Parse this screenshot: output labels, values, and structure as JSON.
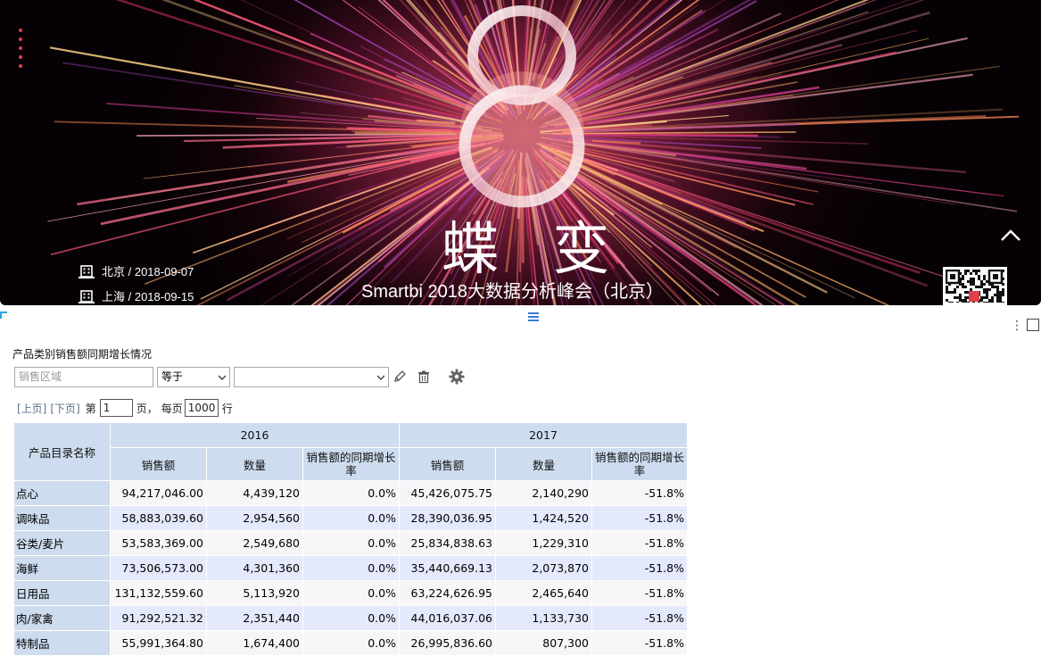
{
  "banner": {
    "title": "蝶 变",
    "subtitle": "Smartbi 2018大数据分析峰会（北京）",
    "locations": [
      {
        "label": "北京 / 2018-09-07"
      },
      {
        "label": "上海 / 2018-09-15"
      }
    ],
    "accent_color": "#e0404a"
  },
  "report": {
    "title": "产品类别销售额同期增长情况",
    "filter": {
      "field_placeholder": "销售区域",
      "operator": "等于",
      "value": ""
    },
    "pager": {
      "prev": "[上页]",
      "next": "[下页]",
      "page_prefix": "第",
      "page_value": "1",
      "page_suffix": "页，",
      "per_page_prefix": "每页",
      "per_page_value": "1000",
      "per_page_suffix": "行"
    },
    "table": {
      "corner_header": "产品目录名称",
      "years": [
        "2016",
        "2017"
      ],
      "metrics": [
        "销售额",
        "数量",
        "销售额的同期增长率"
      ],
      "rows": [
        {
          "name": "点心",
          "c": [
            "94,217,046.00",
            "4,439,120",
            "0.0%",
            "45,426,075.75",
            "2,140,290",
            "-51.8%"
          ]
        },
        {
          "name": "调味品",
          "c": [
            "58,883,039.60",
            "2,954,560",
            "0.0%",
            "28,390,036.95",
            "1,424,520",
            "-51.8%"
          ]
        },
        {
          "name": "谷类/麦片",
          "c": [
            "53,583,369.00",
            "2,549,680",
            "0.0%",
            "25,834,838.63",
            "1,229,310",
            "-51.8%"
          ]
        },
        {
          "name": "海鲜",
          "c": [
            "73,506,573.00",
            "4,301,360",
            "0.0%",
            "35,440,669.13",
            "2,073,870",
            "-51.8%"
          ]
        },
        {
          "name": "日用品",
          "c": [
            "131,132,559.60",
            "5,113,920",
            "0.0%",
            "63,224,626.95",
            "2,465,640",
            "-51.8%"
          ]
        },
        {
          "name": "肉/家禽",
          "c": [
            "91,292,521.32",
            "2,351,440",
            "0.0%",
            "44,016,037.06",
            "1,133,730",
            "-51.8%"
          ]
        },
        {
          "name": "特制品",
          "c": [
            "55,991,364.80",
            "1,674,400",
            "0.0%",
            "26,995,836.60",
            "807,300",
            "-51.8%"
          ]
        }
      ]
    }
  }
}
